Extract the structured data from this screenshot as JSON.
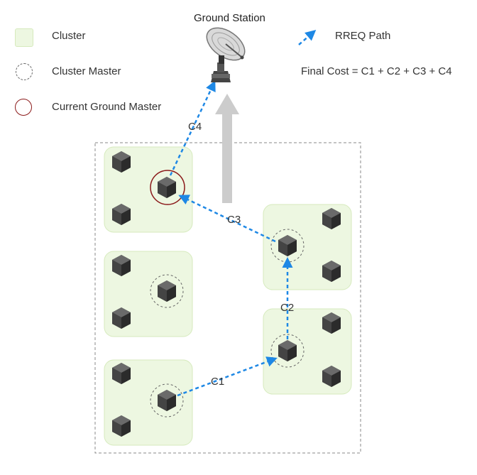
{
  "legend": {
    "cluster": "Cluster",
    "cluster_master": "Cluster Master",
    "current_ground_master": "Current Ground Master",
    "rreq_path": "RREQ Path"
  },
  "ground_station": {
    "label": "Ground Station"
  },
  "formula": "Final Cost = C1 + C2 + C3 + C4",
  "path_labels": {
    "c1": "C1",
    "c2": "C2",
    "c3": "C3",
    "c4": "C4"
  },
  "colors": {
    "cluster_fill": "#edf7e1",
    "cluster_stroke": "#d6eabd",
    "rreq_arrow": "#1e88e5",
    "ground_master_ring": "#8b1a1a",
    "uplink_arrow": "#cccccc"
  },
  "icons": {
    "node": "cube-node-icon",
    "ground_station": "satellite-dish-icon"
  }
}
